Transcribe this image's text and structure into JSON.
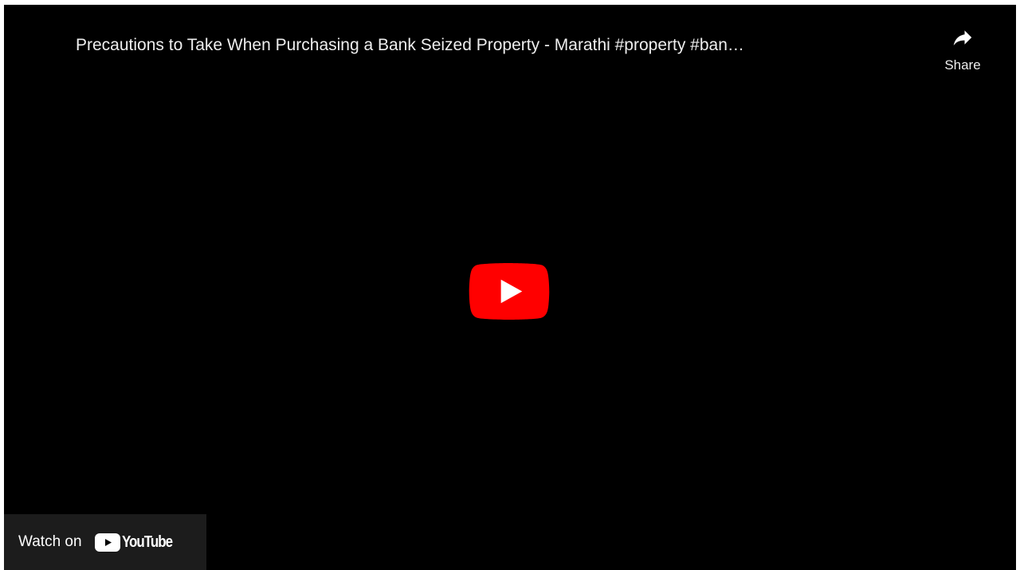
{
  "player": {
    "title": "Precautions to Take When Purchasing a Bank Seized Property - Marathi #property #ban…",
    "share_label": "Share",
    "share_icon": "share-arrow-icon",
    "play_icon": "youtube-play-icon",
    "watch_on_label": "Watch on",
    "logo_text": "YouTube",
    "logo_icon": "youtube-logo-icon",
    "colors": {
      "background": "#000000",
      "play_button_red": "#ff0000",
      "text": "#eeeeee",
      "watch_on_bg": "#212121"
    }
  }
}
